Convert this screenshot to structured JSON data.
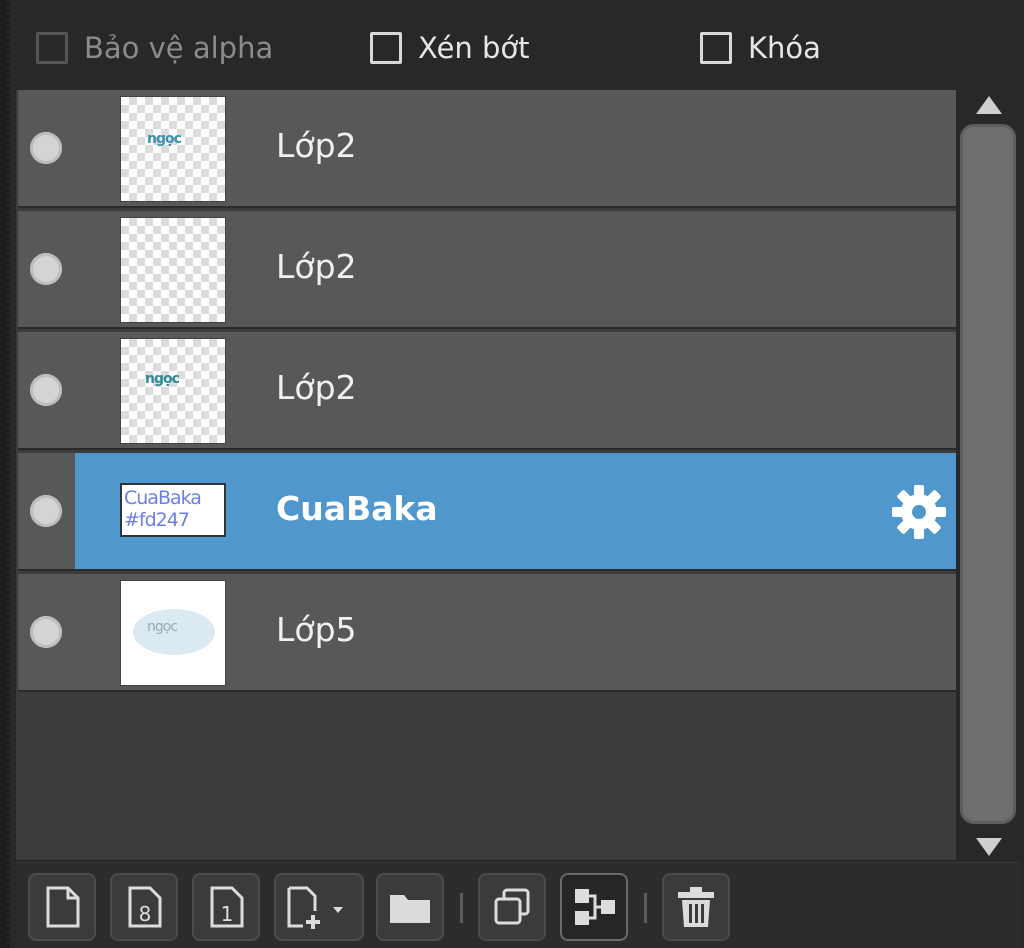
{
  "options": {
    "alpha_protect": "Bảo vệ alpha",
    "clip": "Xén bớt",
    "lock": "Khóa"
  },
  "layers": [
    {
      "name": "Lớp2",
      "thumb_text": "ngọc",
      "selected": false
    },
    {
      "name": "Lớp2",
      "thumb_text": "",
      "selected": false
    },
    {
      "name": "Lớp2",
      "thumb_text": "ngọc",
      "selected": false
    },
    {
      "name": "CuaBaka",
      "thumb_text": "CuaBaka #fd247",
      "selected": true
    },
    {
      "name": "Lớp5",
      "thumb_text": "ngọc",
      "selected": false
    }
  ],
  "colors": {
    "selection": "#4f97cd",
    "row": "#585858",
    "background": "#282828"
  },
  "toolbar": {
    "buttons": [
      "new-layer-icon",
      "new-8bit-layer-icon",
      "new-1bit-layer-icon",
      "add-layer-dropdown-icon",
      "folder-icon",
      "duplicate-icon",
      "merge-layers-icon",
      "trash-icon"
    ]
  }
}
